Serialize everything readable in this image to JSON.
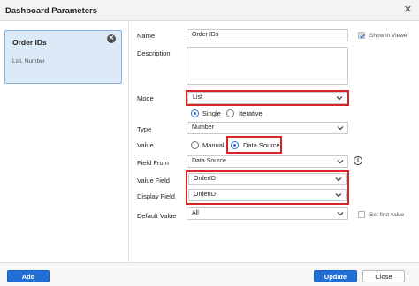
{
  "dialog": {
    "title": "Dashboard Parameters",
    "close_glyph": "✕"
  },
  "parameter": {
    "name": "Order IDs",
    "meta": "List, Number",
    "remove_glyph": "✕"
  },
  "form": {
    "name_label": "Name",
    "name_value": "Order IDs",
    "show_in_viewer_label": "Show in Viewer",
    "show_in_viewer_checked": true,
    "description_label": "Description",
    "description_value": "",
    "mode_label": "Mode",
    "mode_value": "List",
    "mode_options": {
      "single": "Single",
      "iterative": "Iterative",
      "selected": "Single"
    },
    "type_label": "Type",
    "type_value": "Number",
    "value_label": "Value",
    "value_options": {
      "manual": "Manual",
      "data_source": "Data Source",
      "selected": "Data Source"
    },
    "field_from_label": "Field From",
    "field_from_value": "Data Source",
    "info_glyph": "i",
    "value_field_label": "Value Field",
    "value_field_value": "OrderID",
    "display_field_label": "Display Field",
    "display_field_value": "OrderID",
    "default_value_label": "Default Value",
    "default_value_value": "All",
    "set_first_value_label": "Set first value",
    "set_first_value_checked": false
  },
  "footer": {
    "add_label": "Add",
    "update_label": "Update",
    "close_label": "Close"
  },
  "colors": {
    "accent": "#1f6fd6",
    "highlight": "#d9242a",
    "selected_card": "#dce9f7"
  }
}
